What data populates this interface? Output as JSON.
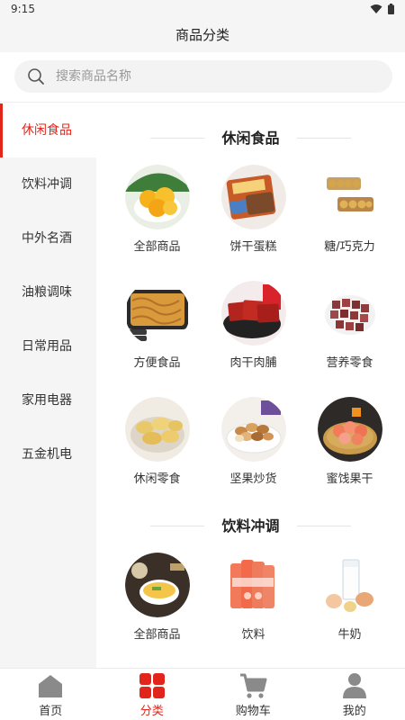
{
  "status": {
    "time": "9:15"
  },
  "header": {
    "title": "商品分类"
  },
  "search": {
    "placeholder": "搜索商品名称"
  },
  "sidebar": {
    "items": [
      {
        "label": "休闲食品",
        "active": true
      },
      {
        "label": "饮料冲调"
      },
      {
        "label": "中外名酒"
      },
      {
        "label": "油粮调味"
      },
      {
        "label": "日常用品"
      },
      {
        "label": "家用电器"
      },
      {
        "label": "五金机电"
      }
    ]
  },
  "sections": [
    {
      "title": "休闲食品",
      "items": [
        {
          "label": "全部商品",
          "icon": "peach-image"
        },
        {
          "label": "饼干蛋糕",
          "icon": "biscuit-pack-image"
        },
        {
          "label": "糖/巧克力",
          "icon": "chocolate-box-image"
        },
        {
          "label": "方便食品",
          "icon": "noodles-image"
        },
        {
          "label": "肉干肉脯",
          "icon": "jerky-image"
        },
        {
          "label": "营养零食",
          "icon": "dates-image"
        },
        {
          "label": "休闲零食",
          "icon": "chips-image"
        },
        {
          "label": "坚果炒货",
          "icon": "nuts-image"
        },
        {
          "label": "蜜饯果干",
          "icon": "dried-fruit-image"
        }
      ]
    },
    {
      "title": "饮料冲调",
      "items": [
        {
          "label": "全部商品",
          "icon": "soup-bowl-image"
        },
        {
          "label": "饮料",
          "icon": "drink-cans-image"
        },
        {
          "label": "牛奶",
          "icon": "milk-glass-image"
        }
      ]
    }
  ],
  "tabbar": {
    "items": [
      {
        "label": "首页",
        "icon": "home-icon"
      },
      {
        "label": "分类",
        "icon": "category-icon",
        "active": true
      },
      {
        "label": "购物车",
        "icon": "cart-icon"
      },
      {
        "label": "我的",
        "icon": "user-icon"
      }
    ]
  },
  "colors": {
    "accent": "#e1251b",
    "sidebar_bg": "#f5f5f5",
    "tab_icon": "#8a8a8a"
  }
}
